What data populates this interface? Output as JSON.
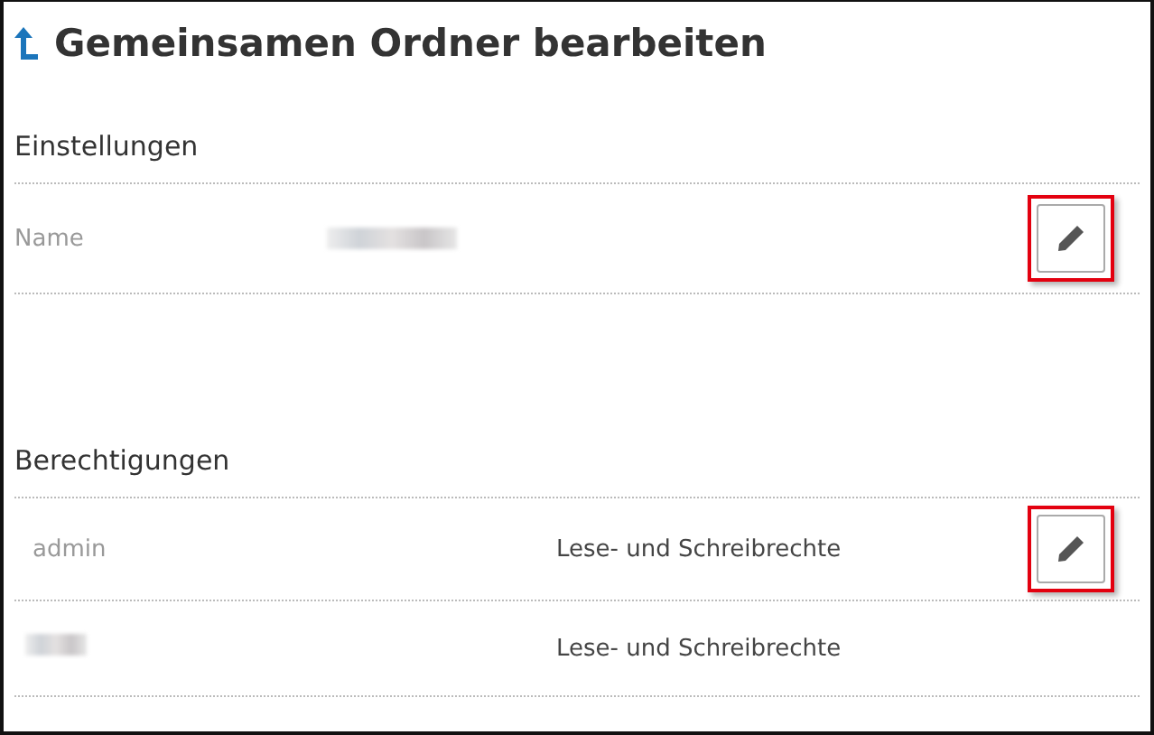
{
  "title": "Gemeinsamen Ordner bearbeiten",
  "settings": {
    "heading": "Einstellungen",
    "rows": [
      {
        "label": "Name",
        "value_redacted": true,
        "edit": {
          "highlighted": true
        }
      }
    ]
  },
  "permissions": {
    "heading": "Berechtigungen",
    "rows": [
      {
        "user": "admin",
        "right": "Lese- und Schreibrechte",
        "edit": {
          "highlighted": true
        }
      },
      {
        "user_redacted": true,
        "right": "Lese- und Schreibrechte"
      }
    ]
  }
}
